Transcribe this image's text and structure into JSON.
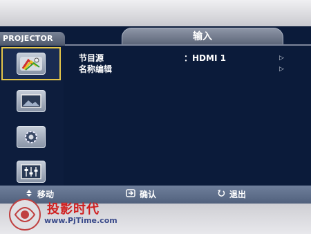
{
  "brand": "PROJECTOR",
  "menu_title": "输入",
  "sidebar": {
    "items": [
      {
        "icon": "input-cables-icon",
        "active": true
      },
      {
        "icon": "picture-icon",
        "active": false
      },
      {
        "icon": "gear-icon",
        "active": false
      },
      {
        "icon": "equalizer-icon",
        "active": false
      }
    ]
  },
  "rows": [
    {
      "label": "节目源",
      "value": "：HDMI 1",
      "arrow": "▷"
    },
    {
      "label": "名称编辑",
      "value": "",
      "arrow": "▷"
    }
  ],
  "footer": {
    "move": "移动",
    "confirm": "确认",
    "exit": "退出"
  },
  "watermark": {
    "title": "投影时代",
    "url": "www.PjTime.com"
  },
  "colors": {
    "screen_bg": "#0b1b3a",
    "active_border": "#e5c64a",
    "footer_bg": "#5f6f8b",
    "watermark_red": "#d02020"
  }
}
